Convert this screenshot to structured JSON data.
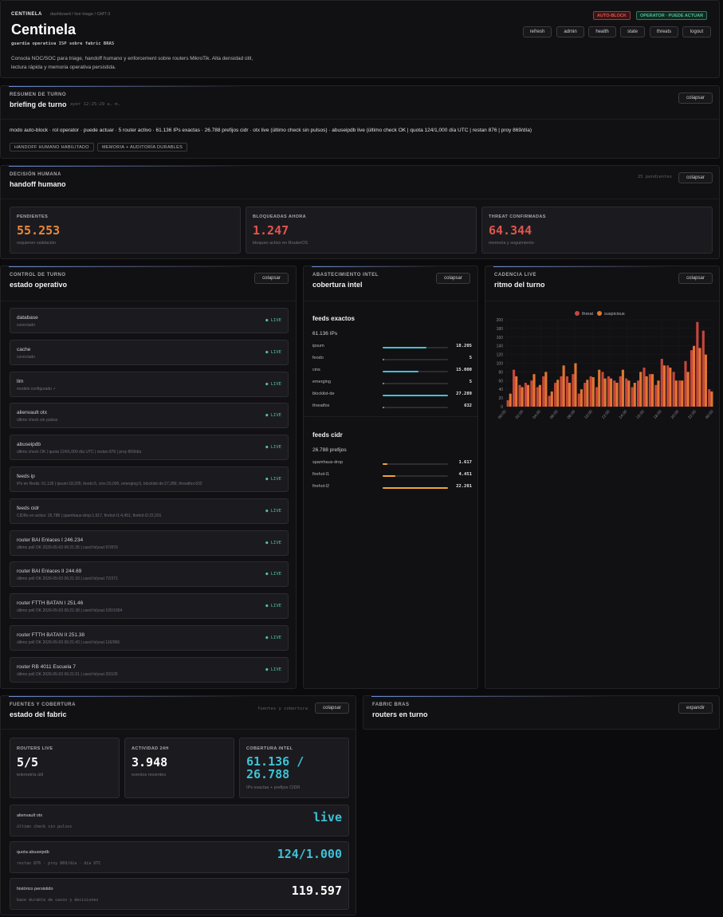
{
  "header": {
    "brand": "CENTINELA",
    "breadcrumb": "dashboard / live triage / GMT-3",
    "title": "Centinela",
    "subtitle": "guardia operativa ISP sobre fabric BRAS",
    "description": "Consola NOC/SOC para triage, handoff humano y enforcement sobre routers MikroTik. Alta densidad útil, lectura rápida y memoria operativa persistida.",
    "badge_mode": "AUTO-BLOCK",
    "badge_operator": "OPERATOR · PUEDE ACTUAR",
    "nav": [
      "refresh",
      "admin",
      "health",
      "state",
      "threats",
      "logout"
    ]
  },
  "briefing": {
    "kicker": "RESUMEN DE TURNO",
    "title": "briefing de turno",
    "timestamp": "ayer 12:25:29 a. m.",
    "collapse": "colapsar",
    "summary": "modo auto-block · rol operator · puede actuar · 5 router activo · 61.136 IPs exactas · 26.788 prefijos cidr · otx live (último check sin pulsos) · abuseipdb live (último check OK | quota 124/1,000 día UTC | restan 876 | proy 869/día)",
    "tags": [
      "HANDOFF HUMANO HABILITADO",
      "MEMORIA + AUDITORÍA DURABLES"
    ]
  },
  "handoff": {
    "kicker": "DECISIÓN HUMANA",
    "title": "handoff humano",
    "pending_note": "25 pendientes",
    "collapse": "colapsar",
    "cards": [
      {
        "label": "PENDIENTES",
        "value": "55.253",
        "sub": "requieren validación"
      },
      {
        "label": "BLOQUEADAS AHORA",
        "value": "1.247",
        "sub": "bloqueo activo en RouterOS"
      },
      {
        "label": "THREAT CONFIRMADAS",
        "value": "64.344",
        "sub": "memoria y seguimiento"
      }
    ],
    "colors": {
      "pending": "#e9873a",
      "blocked": "#e0554d",
      "threat": "#e0554d"
    }
  },
  "status": {
    "kicker": "CONTROL DE TURNO",
    "title": "estado operativo",
    "collapse": "colapsar",
    "rows": [
      {
        "name": "database",
        "detail": "conectado",
        "state": "● LIVE"
      },
      {
        "name": "cache",
        "detail": "conectado",
        "state": "● LIVE"
      },
      {
        "name": "llm",
        "detail": "modelo configurado ✓",
        "state": "● LIVE"
      },
      {
        "name": "alienvault otx",
        "detail": "último check sin pulsos",
        "state": "● LIVE"
      },
      {
        "name": "abuseipdb",
        "detail": "último check OK | quota 124/1,000 día UTC | restan 876 | proy 869/día",
        "state": "● LIVE"
      },
      {
        "name": "feeds ip",
        "detail": "IPs en Redis: 61,136 | ipsum:18,205, feodo:5, cins:15,000, emerging:5, blocklist-de:27,289, threatfox:632",
        "state": "● LIVE"
      },
      {
        "name": "feeds cidr",
        "detail": "CIDRs en activo: 26,788 | spamhaus-drop:1,617, firehol-l1:4,451, firehol-l2:22,201",
        "state": "● LIVE"
      },
      {
        "name": "router BAI Enlaces I 246.234",
        "detail": "último poll OK 2026-05-03 06:21:35 | cand hi/yout 97/870",
        "state": "● LIVE"
      },
      {
        "name": "router BAI Enlaces II 244.69",
        "detail": "último poll OK 2026-05-03 06:21:33 | cand hi/yout 72/371",
        "state": "● LIVE"
      },
      {
        "name": "router FTTH BATAN I 251.46",
        "detail": "último poll OK 2026-05-03 06:21:38 | cand hi/yout 105/1004",
        "state": "● LIVE"
      },
      {
        "name": "router FTTH BATAN II 251.38",
        "detail": "último poll OK 2026-05-03 06:21:43 | cand hi/yout 116/956",
        "state": "● LIVE"
      },
      {
        "name": "router RB 4011 Escuela 7",
        "detail": "último poll OK 2026-05-03 06:21:51 | cand hi/yout 20/105",
        "state": "● LIVE"
      }
    ]
  },
  "intel": {
    "kicker": "ABASTECIMIENTO INTEL",
    "title": "cobertura intel",
    "collapse": "colapsar",
    "exact_title": "feeds exactos",
    "exact_count": "61.136 IPs",
    "exact": [
      {
        "name": "ipsum",
        "value": "18.205",
        "fraction": 0.67
      },
      {
        "name": "feodo",
        "value": "5",
        "fraction": 0.02
      },
      {
        "name": "cins",
        "value": "15.000",
        "fraction": 0.55
      },
      {
        "name": "emerging",
        "value": "5",
        "fraction": 0.02
      },
      {
        "name": "blocklist-de",
        "value": "27.289",
        "fraction": 1.0
      },
      {
        "name": "threatfox",
        "value": "632",
        "fraction": 0.03
      }
    ],
    "cidr_title": "feeds cidr",
    "cidr_count": "26.788 prefijos",
    "cidr": [
      {
        "name": "spamhaus-drop",
        "value": "1.617",
        "fraction": 0.07
      },
      {
        "name": "firehol-l1",
        "value": "4.451",
        "fraction": 0.2
      },
      {
        "name": "firehol-l2",
        "value": "22.201",
        "fraction": 1.0
      }
    ],
    "colors": {
      "exact": "#3fc1d6",
      "cidr": "#f0a43a"
    }
  },
  "cadence": {
    "kicker": "CADENCIA LIVE",
    "title": "ritmo del turno",
    "collapse": "colapsar"
  },
  "chart_data": {
    "type": "bar",
    "title": "",
    "legend_position": "top-center",
    "ylim": [
      0,
      200
    ],
    "yticks": [
      "0",
      "20",
      "40",
      "60",
      "80",
      "100",
      "120",
      "140",
      "160",
      "180",
      "200"
    ],
    "xticks": [
      "00:00",
      "02:00",
      "04:00",
      "06:00",
      "08:00",
      "10:00",
      "12:00",
      "14:00",
      "16:00",
      "18:00",
      "20:00",
      "22:00",
      "00:00"
    ],
    "grid": true,
    "series": [
      {
        "name": "threat",
        "color": "#c7463d",
        "values": [
          15,
          85,
          50,
          55,
          60,
          45,
          70,
          25,
          55,
          70,
          70,
          75,
          30,
          55,
          70,
          45,
          80,
          70,
          60,
          70,
          65,
          45,
          60,
          90,
          75,
          50,
          110,
          95,
          80,
          60,
          105,
          130,
          195,
          175,
          40
        ]
      },
      {
        "name": "suspicious",
        "color": "#e0772e",
        "values": [
          30,
          70,
          45,
          50,
          75,
          50,
          80,
          35,
          62,
          95,
          55,
          100,
          40,
          62,
          68,
          85,
          65,
          65,
          55,
          85,
          60,
          55,
          80,
          70,
          75,
          60,
          95,
          90,
          60,
          60,
          80,
          140,
          135,
          120,
          35
        ]
      }
    ]
  },
  "fabric_status": {
    "kicker": "FUENTES Y COBERTURA",
    "title": "estado del fabric",
    "note": "fuentes y cobertura",
    "collapse": "colapsar",
    "cards": [
      {
        "label": "ROUTERS LIVE",
        "value": "5/5",
        "sub": "telemetría útil"
      },
      {
        "label": "ACTIVIDAD 24H",
        "value": "3.948",
        "sub": "eventos recientes"
      },
      {
        "label": "COBERTURA INTEL",
        "value": "61.136 / 26.788",
        "sub": "IPs exactas + prefijos CIDR"
      }
    ],
    "rows": [
      {
        "label": "alienvault otx",
        "sub": "último check sin pulsos",
        "value": "live",
        "color": "#3fc1d6"
      },
      {
        "label": "quota abuseipdb",
        "sub": "restan 876 · proy 869/día · día UTC",
        "value": "124/1.000",
        "color": "#3fc1d6"
      },
      {
        "label": "histórico persistido",
        "sub": "base durable de casos y decisiones",
        "value": "119.597",
        "color": "#ffffff"
      }
    ]
  },
  "routers": {
    "kicker": "FABRIC BRAS",
    "title": "routers en turno",
    "expand": "expandir"
  }
}
